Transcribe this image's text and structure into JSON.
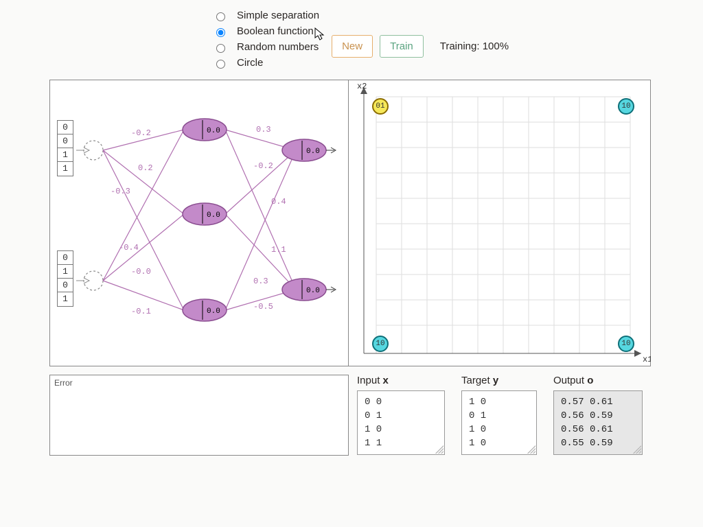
{
  "controls": {
    "datasets": [
      {
        "id": "simple",
        "label": "Simple separation",
        "selected": false
      },
      {
        "id": "boolean",
        "label": "Boolean function",
        "selected": true
      },
      {
        "id": "random",
        "label": "Random numbers",
        "selected": false
      },
      {
        "id": "circle",
        "label": "Circle",
        "selected": false
      }
    ],
    "new_label": "New",
    "train_label": "Train",
    "training_status": "Training: 100%"
  },
  "network": {
    "input_vectors": [
      [
        "0",
        "0",
        "1",
        "1"
      ],
      [
        "0",
        "1",
        "0",
        "1"
      ]
    ],
    "weights": [
      "-0.2",
      "0.2",
      "-0.3",
      "-0.4",
      "-0.0",
      "-0.1",
      "0.3",
      "-0.2",
      "0.4",
      "1.1",
      "0.3",
      "-0.5"
    ],
    "hidden_values": [
      "0.0",
      "0.0",
      "0.0"
    ],
    "output_values": [
      "0.0",
      "0.0"
    ]
  },
  "plot": {
    "x_axis": "x1",
    "y_axis": "x2",
    "points": [
      {
        "x": 0,
        "y": 1,
        "label": "01",
        "class": "yel"
      },
      {
        "x": 1,
        "y": 1,
        "label": "10",
        "class": "cyan"
      },
      {
        "x": 0,
        "y": 0,
        "label": "10",
        "class": "cyan"
      },
      {
        "x": 1,
        "y": 0,
        "label": "10",
        "class": "cyan"
      }
    ]
  },
  "bottom": {
    "error_label": "Error",
    "input_header_a": "Input ",
    "input_header_b": "x",
    "target_header_a": "Target ",
    "target_header_b": "y",
    "output_header_a": "Output ",
    "output_header_b": "o",
    "input_rows": [
      "0 0",
      "0 1",
      "1 0",
      "1 1"
    ],
    "target_rows": [
      "1 0",
      "0 1",
      "1 0",
      "1 0"
    ],
    "output_rows": [
      "0.57 0.61",
      "0.56 0.59",
      "0.56 0.61",
      "0.55 0.59"
    ]
  }
}
